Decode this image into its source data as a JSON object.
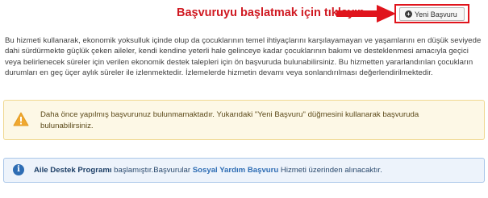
{
  "header": {
    "annotation": "Başvuruyu başlatmak için tıklayın.",
    "new_application_button": "Yeni Başvuru",
    "icons": {
      "button": "plus-circle-icon",
      "arrow": "arrow-right-icon"
    },
    "colors": {
      "annotation": "#d01a22",
      "highlight_frame": "#e0141c"
    }
  },
  "intro": {
    "text": "Bu hizmeti kullanarak, ekonomik yoksulluk içinde olup da çocuklarının temel ihtiyaçlarını karşılayamayan ve yaşamlarını en düşük seviyede dahi sürdürmekte güçlük çeken aileler, kendi kendine yeterli hale gelinceye kadar çocuklarının bakımı ve desteklenmesi amacıyla geçici veya belirlenecek süreler için verilen ekonomik destek talepleri için ön başvuruda bulunabilirsiniz. Bu hizmetten yararlandırılan çocukların durumları en geç üçer aylık süreler ile izlenmektedir. İzlemelerde hizmetin devamı veya sonlandırılması değerlendirilmektedir."
  },
  "warning": {
    "icon": "warning-triangle-icon",
    "text": "Daha önce yapılmış başvurunuz bulunmamaktadır. Yukarıdaki \"Yeni Başvuru\" düğmesini kullanarak başvuruda bulunabilirsiniz.",
    "colors": {
      "background": "#fdf8e6",
      "border": "#f0d891",
      "icon": "#f0a830"
    }
  },
  "info": {
    "icon": "info-circle-icon",
    "bold_program": "Aile Destek Programı",
    "text_middle": " başlamıştır.Başvurular ",
    "link_text": "Sosyal Yardım Başvuru",
    "text_end": " Hizmeti üzerinden alınacaktır.",
    "colors": {
      "background": "#edf3fb",
      "border": "#a9c6e8",
      "icon": "#2e6db4"
    }
  }
}
